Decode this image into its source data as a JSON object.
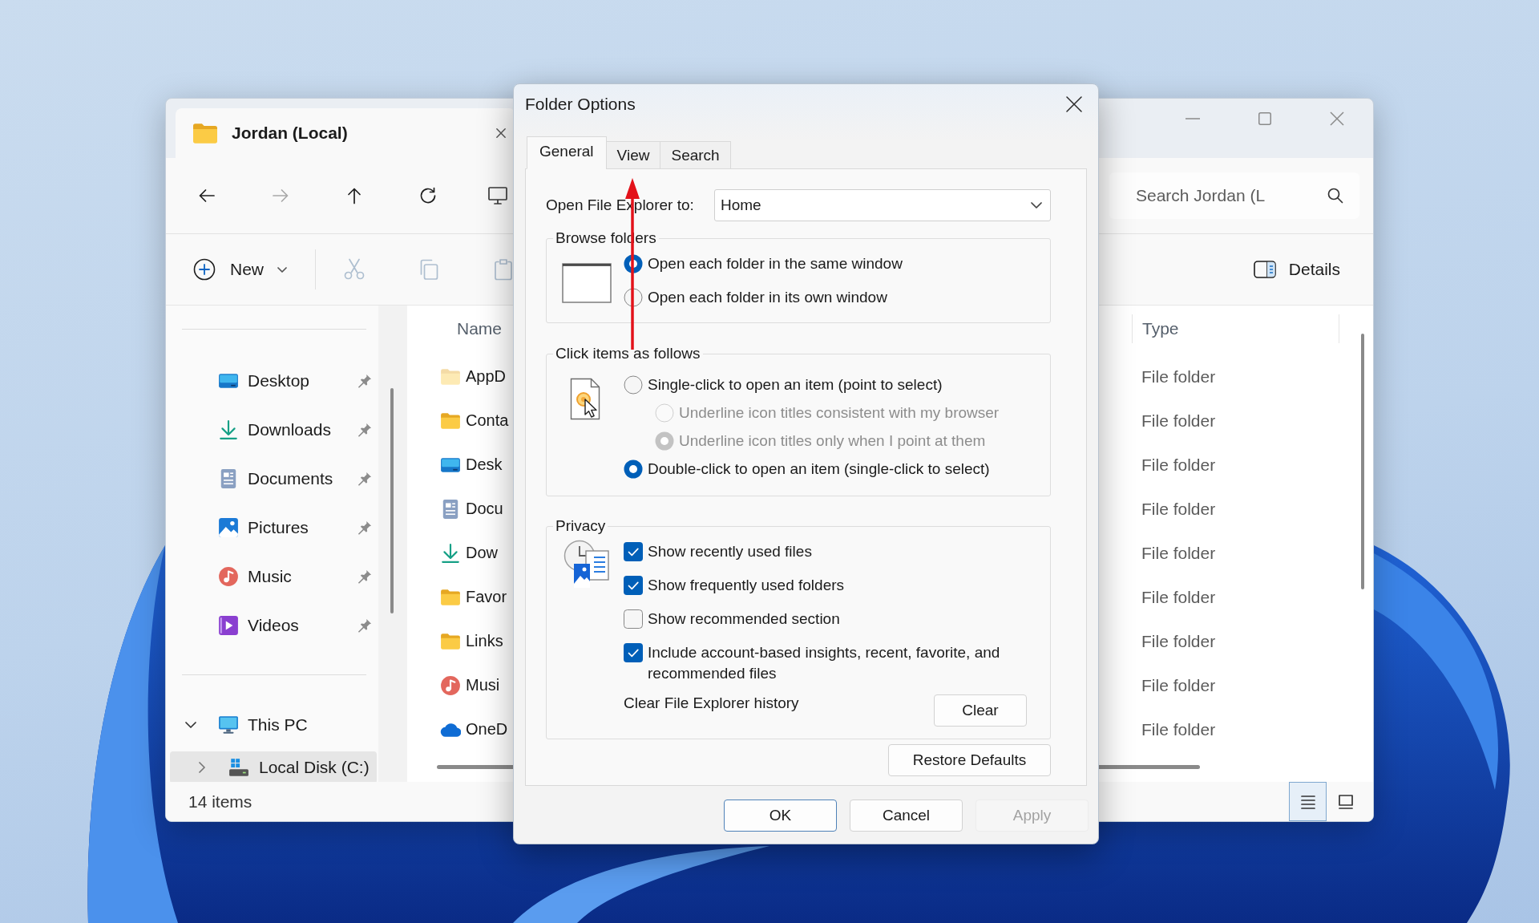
{
  "explorer": {
    "tab_title": "Jordan (Local)",
    "navigation": [
      {
        "kind": "back",
        "disabled": false
      },
      {
        "kind": "forward",
        "disabled": true
      },
      {
        "kind": "up",
        "disabled": false
      },
      {
        "kind": "refresh",
        "disabled": false
      }
    ],
    "search": {
      "placeholder": "Search Jordan (L"
    },
    "toolbar": {
      "new_label": "New",
      "actions": [
        {
          "kind": "cut",
          "disabled": true
        },
        {
          "kind": "copy",
          "disabled": true
        },
        {
          "kind": "paste",
          "disabled": true
        }
      ],
      "details_label": "Details"
    },
    "sidebar": {
      "quick_access": [
        {
          "label": "Desktop",
          "kind": "desktop",
          "pinned": true
        },
        {
          "label": "Downloads",
          "kind": "downloads",
          "pinned": true
        },
        {
          "label": "Documents",
          "kind": "documents",
          "pinned": true
        },
        {
          "label": "Pictures",
          "kind": "pictures",
          "pinned": true
        },
        {
          "label": "Music",
          "kind": "music",
          "pinned": true
        },
        {
          "label": "Videos",
          "kind": "videos",
          "pinned": true
        }
      ],
      "tree": [
        {
          "label": "This PC",
          "kind": "pc",
          "expanded": true,
          "selected": false,
          "children": [
            {
              "label": "Local Disk (C:)",
              "kind": "disk",
              "expanded": false,
              "selected": true
            }
          ]
        }
      ]
    },
    "files": {
      "columns": [
        "Name",
        "Type"
      ],
      "rows": [
        {
          "name": "AppD",
          "kind": "folder",
          "hidden": true,
          "type": "File folder"
        },
        {
          "name": "Conta",
          "kind": "folder",
          "hidden": false,
          "type": "File folder"
        },
        {
          "name": "Desk",
          "kind": "desktop",
          "hidden": false,
          "type": "File folder"
        },
        {
          "name": "Docu",
          "kind": "documents",
          "hidden": false,
          "type": "File folder"
        },
        {
          "name": "Dow",
          "kind": "downloads",
          "hidden": false,
          "type": "File folder"
        },
        {
          "name": "Favor",
          "kind": "folder",
          "hidden": false,
          "type": "File folder"
        },
        {
          "name": "Links",
          "kind": "folder",
          "hidden": false,
          "type": "File folder"
        },
        {
          "name": "Musi",
          "kind": "music",
          "hidden": false,
          "type": "File folder"
        },
        {
          "name": "OneD",
          "kind": "cloud",
          "hidden": false,
          "type": "File folder"
        }
      ]
    },
    "status": "14 items",
    "view_modes": [
      {
        "kind": "details",
        "selected": true
      },
      {
        "kind": "tiles",
        "selected": false
      }
    ]
  },
  "dialog": {
    "title": "Folder Options",
    "tabs": [
      {
        "label": "General",
        "selected": true
      },
      {
        "label": "View",
        "selected": false
      },
      {
        "label": "Search",
        "selected": false
      }
    ],
    "open_to": {
      "label": "Open File Explorer to:",
      "value": "Home"
    },
    "browse_folders": {
      "legend": "Browse folders",
      "options": [
        {
          "label": "Open each folder in the same window",
          "selected": true
        },
        {
          "label": "Open each folder in its own window",
          "selected": false
        }
      ]
    },
    "click_items": {
      "legend": "Click items as follows",
      "options": [
        {
          "label": "Single-click to open an item (point to select)",
          "selected": false,
          "disabled": false,
          "children": [
            {
              "label": "Underline icon titles consistent with my browser",
              "selected": false,
              "disabled": true
            },
            {
              "label": "Underline icon titles only when I point at them",
              "selected": true,
              "disabled": true
            }
          ]
        },
        {
          "label": "Double-click to open an item (single-click to select)",
          "selected": true,
          "disabled": false
        }
      ]
    },
    "privacy": {
      "legend": "Privacy",
      "options": [
        {
          "label": "Show recently used files",
          "checked": true
        },
        {
          "label": "Show frequently used folders",
          "checked": true
        },
        {
          "label": "Show recommended section",
          "checked": false
        },
        {
          "label": "Include account-based insights, recent, favorite, and recommended files",
          "checked": true
        }
      ],
      "history_label": "Clear File Explorer history",
      "clear_button": "Clear"
    },
    "restore_button": "Restore Defaults",
    "buttons": [
      {
        "label": "OK",
        "default": true,
        "disabled": false
      },
      {
        "label": "Cancel",
        "default": false,
        "disabled": false
      },
      {
        "label": "Apply",
        "default": false,
        "disabled": true
      }
    ]
  }
}
